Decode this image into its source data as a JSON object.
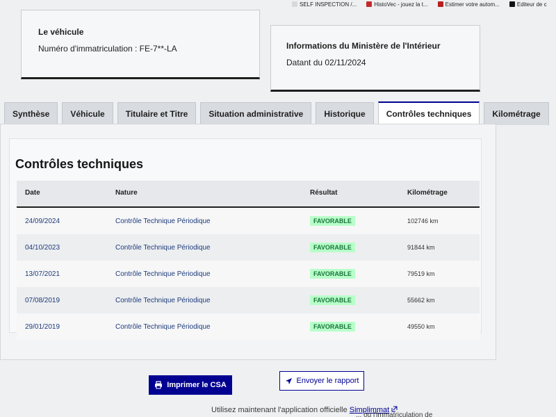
{
  "bookmarks": [
    {
      "label": "SELF INSPECTION /...",
      "color": "#d9d9d9"
    },
    {
      "label": "HistoVec - jouez la t...",
      "color": "#c22a2a"
    },
    {
      "label": "Estimer votre autom...",
      "color": "#b81f1f"
    },
    {
      "label": "Editeur de c",
      "color": "#111111"
    }
  ],
  "vehicle_card": {
    "title": "Le véhicule",
    "plate_line": "Numéro d'immatriculation : FE-7**-LA"
  },
  "ministry_card": {
    "title": "Informations du Ministère de l'Intérieur",
    "date_line": "Datant du 02/11/2024"
  },
  "tabs": [
    {
      "label": "Synthèse",
      "active": false
    },
    {
      "label": "Véhicule",
      "active": false
    },
    {
      "label": "Titulaire et Titre",
      "active": false
    },
    {
      "label": "Situation administrative",
      "active": false
    },
    {
      "label": "Historique",
      "active": false
    },
    {
      "label": "Contrôles techniques",
      "active": true
    },
    {
      "label": "Kilométrage",
      "active": false
    }
  ],
  "section": {
    "title": "Contrôles techniques",
    "columns": [
      "Date",
      "Nature",
      "Résultat",
      "Kilométrage"
    ],
    "rows": [
      {
        "date": "24/09/2024",
        "nature": "Contrôle Technique Périodique",
        "result": "FAVORABLE",
        "km": "102746 km"
      },
      {
        "date": "04/10/2023",
        "nature": "Contrôle Technique Périodique",
        "result": "FAVORABLE",
        "km": "91844 km"
      },
      {
        "date": "13/07/2021",
        "nature": "Contrôle Technique Périodique",
        "result": "FAVORABLE",
        "km": "79519 km"
      },
      {
        "date": "07/08/2019",
        "nature": "Contrôle Technique Périodique",
        "result": "FAVORABLE",
        "km": "55662 km"
      },
      {
        "date": "29/01/2019",
        "nature": "Contrôle Technique Périodique",
        "result": "FAVORABLE",
        "km": "49550 km"
      }
    ]
  },
  "actions": {
    "print_label": "Imprimer le CSA",
    "send_label": "Envoyer le rapport"
  },
  "footer": {
    "text_before": "Utilisez maintenant l'application officielle ",
    "link": "Simplimmat",
    "line2": "... ou l'immatriculation de"
  },
  "colors": {
    "accent": "#000091",
    "success_bg": "#b8fec9",
    "success_fg": "#18753c"
  }
}
